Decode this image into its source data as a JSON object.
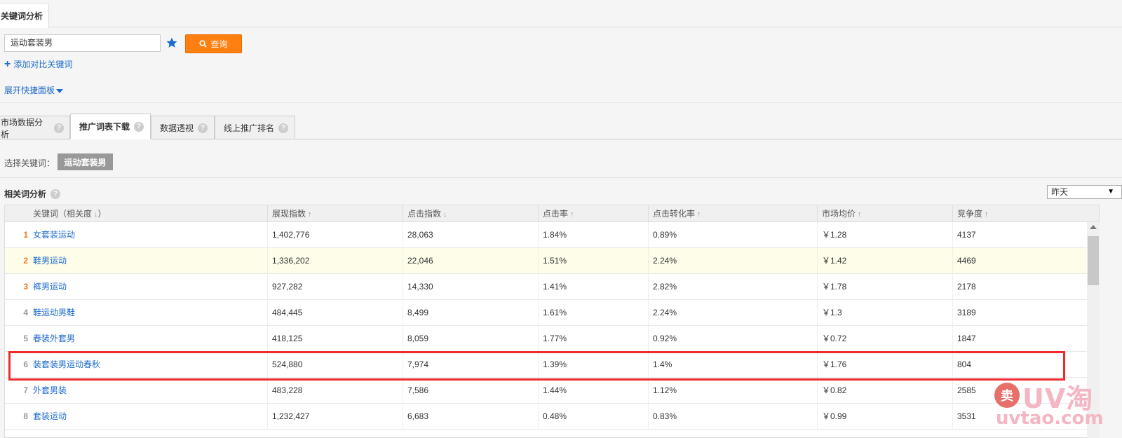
{
  "top_tab": {
    "label": "关键词分析"
  },
  "search": {
    "value": "运动套装男"
  },
  "query_button": {
    "label": "查询"
  },
  "add_compare": {
    "label": "添加对比关键词"
  },
  "expand_panel": {
    "label": "展开快捷面板"
  },
  "sub_tabs": [
    {
      "label": "市场数据分析",
      "help": "?"
    },
    {
      "label": "推广词表下载",
      "help": "?"
    },
    {
      "label": "数据透视",
      "help": "?"
    },
    {
      "label": "线上推广排名",
      "help": "?"
    }
  ],
  "select_keyword": {
    "label": "选择关键词：",
    "chip": "运动套装男"
  },
  "related": {
    "title": "相关词分析",
    "help": "?",
    "period": "昨天"
  },
  "table": {
    "headers": [
      {
        "label": "关键词（相关度",
        "arrow": "↓",
        "suffix": "）"
      },
      {
        "label": "展现指数",
        "arrow": "↑"
      },
      {
        "label": "点击指数",
        "arrow": "↓"
      },
      {
        "label": "点击率",
        "arrow": "↑"
      },
      {
        "label": "点击转化率",
        "arrow": "↑"
      },
      {
        "label": "市场均价",
        "arrow": "↑"
      },
      {
        "label": "竞争度",
        "arrow": "↑"
      }
    ],
    "rows": [
      {
        "rank": "1",
        "keyword": "女套装运动",
        "impressions": "1,402,776",
        "clicks": "28,063",
        "ctr": "1.84%",
        "cvr": "0.89%",
        "price": "￥1.28",
        "competition": "4137"
      },
      {
        "rank": "2",
        "keyword": "鞋男运动",
        "impressions": "1,336,202",
        "clicks": "22,046",
        "ctr": "1.51%",
        "cvr": "2.24%",
        "price": "￥1.42",
        "competition": "4469"
      },
      {
        "rank": "3",
        "keyword": "裤男运动",
        "impressions": "927,282",
        "clicks": "14,330",
        "ctr": "1.41%",
        "cvr": "2.82%",
        "price": "￥1.78",
        "competition": "2178"
      },
      {
        "rank": "4",
        "keyword": "鞋运动男鞋",
        "impressions": "484,445",
        "clicks": "8,499",
        "ctr": "1.61%",
        "cvr": "2.24%",
        "price": "￥1.3",
        "competition": "3189"
      },
      {
        "rank": "5",
        "keyword": "春装外套男",
        "impressions": "418,125",
        "clicks": "8,059",
        "ctr": "1.77%",
        "cvr": "0.92%",
        "price": "￥0.72",
        "competition": "1847"
      },
      {
        "rank": "6",
        "keyword": "装套装男运动春秋",
        "impressions": "524,880",
        "clicks": "7,974",
        "ctr": "1.39%",
        "cvr": "1.4%",
        "price": "￥1.76",
        "competition": "804"
      },
      {
        "rank": "7",
        "keyword": "外套男装",
        "impressions": "483,228",
        "clicks": "7,586",
        "ctr": "1.44%",
        "cvr": "1.12%",
        "price": "￥0.82",
        "competition": "2585"
      },
      {
        "rank": "8",
        "keyword": "套装运动",
        "impressions": "1,232,427",
        "clicks": "6,683",
        "ctr": "0.48%",
        "cvr": "0.83%",
        "price": "￥0.99",
        "competition": "3531"
      }
    ]
  },
  "watermark": {
    "badge": "卖",
    "brand": "UV淘",
    "site": "uvtao.com"
  },
  "colors": {
    "accent_orange": "#ff7f10",
    "link_blue": "#1e6bcc",
    "highlight_red": "#ee2a2f",
    "rank_orange": "#f0781e"
  }
}
